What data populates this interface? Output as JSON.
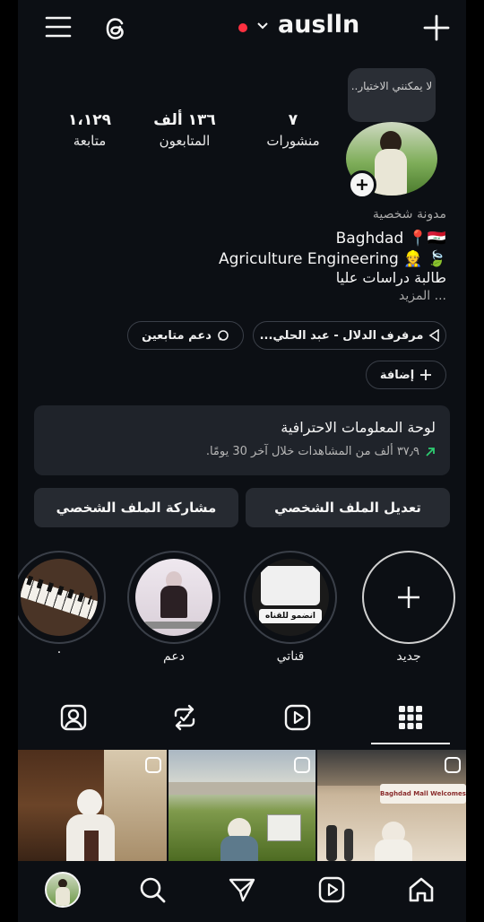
{
  "header": {
    "username": "auslln",
    "menu_icon": "hamburger-menu-icon",
    "threads_icon": "threads-icon",
    "add_icon": "plus-icon"
  },
  "tooltip": {
    "text": "لا يمكنني الاختيار.."
  },
  "stats": [
    {
      "key": "posts",
      "value": "٧",
      "label": "منشورات"
    },
    {
      "key": "followers",
      "value": "١٣٦ ألف",
      "label": "المتابعون"
    },
    {
      "key": "following",
      "value": "١،١٢٩",
      "label": "متابعة"
    }
  ],
  "bio": {
    "category": "مدونة شخصية",
    "line1": "Baghdad 📍🇮🇶",
    "line2": "Agriculture Engineering 👷 🍃",
    "line3": "طالبة دراسات عليا",
    "more": "... المزيد"
  },
  "links": {
    "music": "مرفرف الدلال - عبد الحلي...",
    "support": "دعم متابعين",
    "add": "إضافة"
  },
  "dashboard": {
    "title": "لوحة المعلومات الاحترافية",
    "subtitle": "٣٧٫٩ ألف من المشاهدات خلال آخر 30 يومًا."
  },
  "buttons": {
    "edit": "تعديل الملف الشخصي",
    "share": "مشاركة الملف الشخصي"
  },
  "highlights": [
    {
      "label": "جديد"
    },
    {
      "label": "قناتي",
      "card_text": "انضمو للقناه"
    },
    {
      "label": "دعم"
    },
    {
      "label": "."
    }
  ],
  "tabs": [
    "grid-icon",
    "reels-icon",
    "reposts-icon",
    "tagged-icon"
  ],
  "bottom_nav": [
    "home-icon",
    "reels-icon",
    "send-icon",
    "search-icon",
    "profile-avatar"
  ],
  "grid_post_caption": "Baghdad Mall Welcomes You.",
  "colors": {
    "background": "#0c0f14",
    "card": "#1f232a",
    "accent_green": "#2ecc71",
    "live_dot": "#ff3040"
  }
}
